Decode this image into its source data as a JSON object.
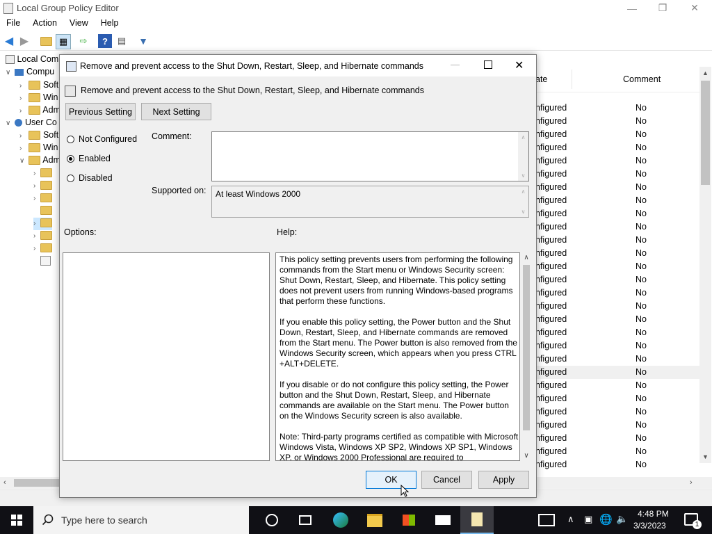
{
  "window": {
    "title": "Local Group Policy Editor"
  },
  "menu": [
    "File",
    "Action",
    "View",
    "Help"
  ],
  "tree": {
    "items": [
      {
        "label": "Local Comp",
        "indent": 0
      },
      {
        "label": "Compu",
        "indent": 1
      },
      {
        "label": "Soft",
        "indent": 2
      },
      {
        "label": "Win",
        "indent": 2
      },
      {
        "label": "Adm",
        "indent": 2
      },
      {
        "label": "User Co",
        "indent": 1
      },
      {
        "label": "Soft",
        "indent": 2
      },
      {
        "label": "Win",
        "indent": 2
      },
      {
        "label": "Adm",
        "indent": 2
      }
    ]
  },
  "list": {
    "col_state": "ate",
    "col_comment": "Comment",
    "rows": [
      {
        "state": "nfigured",
        "comment": "No"
      },
      {
        "state": "nfigured",
        "comment": "No"
      },
      {
        "state": "nfigured",
        "comment": "No"
      },
      {
        "state": "nfigured",
        "comment": "No"
      },
      {
        "state": "nfigured",
        "comment": "No"
      },
      {
        "state": "nfigured",
        "comment": "No"
      },
      {
        "state": "nfigured",
        "comment": "No"
      },
      {
        "state": "nfigured",
        "comment": "No"
      },
      {
        "state": "nfigured",
        "comment": "No"
      },
      {
        "state": "nfigured",
        "comment": "No"
      },
      {
        "state": "nfigured",
        "comment": "No"
      },
      {
        "state": "nfigured",
        "comment": "No"
      },
      {
        "state": "nfigured",
        "comment": "No"
      },
      {
        "state": "nfigured",
        "comment": "No"
      },
      {
        "state": "nfigured",
        "comment": "No"
      },
      {
        "state": "nfigured",
        "comment": "No"
      },
      {
        "state": "nfigured",
        "comment": "No"
      },
      {
        "state": "nfigured",
        "comment": "No"
      },
      {
        "state": "nfigured",
        "comment": "No"
      },
      {
        "state": "nfigured",
        "comment": "No"
      },
      {
        "state": "nfigured",
        "comment": "No"
      },
      {
        "state": "nfigured",
        "comment": "No"
      },
      {
        "state": "nfigured",
        "comment": "No"
      },
      {
        "state": "nfigured",
        "comment": "No"
      },
      {
        "state": "nfigured",
        "comment": "No"
      },
      {
        "state": "nfigured",
        "comment": "No"
      },
      {
        "state": "nfigured",
        "comment": "No"
      },
      {
        "state": "nfigured",
        "comment": "No"
      }
    ],
    "selected_row_index": 20
  },
  "dialog": {
    "title": "Remove and prevent access to the Shut Down, Restart, Sleep, and Hibernate commands",
    "heading": "Remove and prevent access to the Shut Down, Restart, Sleep, and Hibernate commands",
    "prev_label": "Previous Setting",
    "next_label": "Next Setting",
    "radios": [
      {
        "label": "Not Configured",
        "checked": false
      },
      {
        "label": "Enabled",
        "checked": true
      },
      {
        "label": "Disabled",
        "checked": false
      }
    ],
    "comment_label": "Comment:",
    "comment_value": "",
    "supported_label": "Supported on:",
    "supported_value": "At least Windows 2000",
    "options_label": "Options:",
    "help_label": "Help:",
    "help_paragraphs": [
      "This policy setting prevents users from performing the following commands from the Start menu or Windows Security screen: Shut Down, Restart, Sleep, and Hibernate. This policy setting does not prevent users from running Windows-based programs that perform these functions.",
      "If you enable this policy setting, the Power button and the Shut Down, Restart, Sleep, and Hibernate commands are removed from the Start menu. The Power button is also removed from the Windows Security screen, which appears when you press CTRL +ALT+DELETE.",
      "If you disable or do not configure this policy setting, the Power button and the Shut Down, Restart, Sleep, and Hibernate commands are available on the Start menu. The Power button on the Windows Security screen is also available.",
      "Note: Third-party programs certified as compatible with Microsoft Windows Vista, Windows XP SP2, Windows XP SP1, Windows XP, or Windows 2000 Professional are required to"
    ],
    "ok_label": "OK",
    "cancel_label": "Cancel",
    "apply_label": "Apply"
  },
  "taskbar": {
    "search_placeholder": "Type here to search",
    "time": "4:48 PM",
    "date": "3/3/2023",
    "notification_count": "1"
  },
  "colors": {
    "accent": "#0078d7",
    "taskbar": "#101015",
    "folder": "#e8c35a"
  }
}
